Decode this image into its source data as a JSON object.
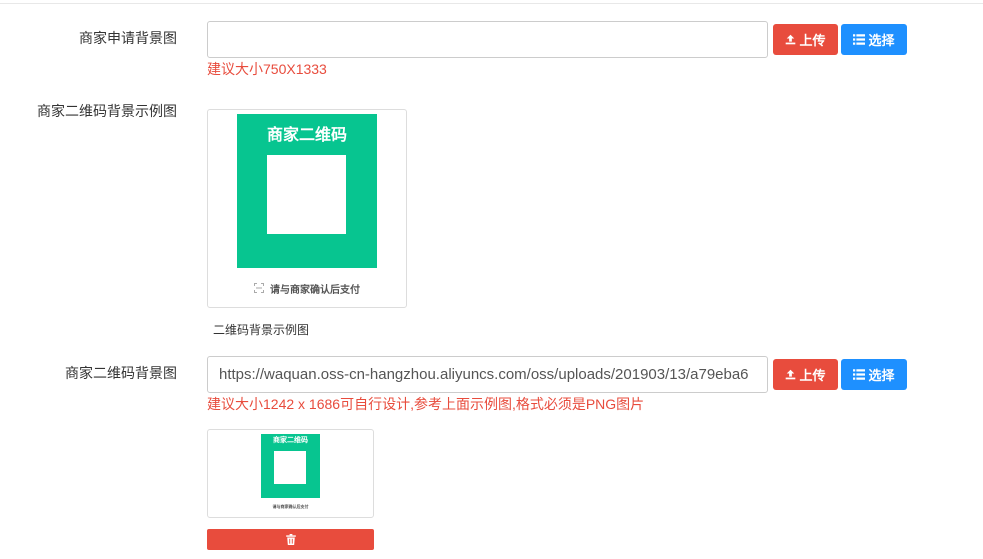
{
  "colors": {
    "danger": "#e84c3d",
    "primary": "#1e90ff",
    "qr_green": "#07c590",
    "hint_text": "#e84c3d",
    "label_text": "#333333"
  },
  "icons": {
    "upload": "upload-icon",
    "select": "list-icon",
    "delete": "trash-icon",
    "scan": "scan-icon"
  },
  "form": {
    "apply_background": {
      "label": "商家申请背景图",
      "upload_label": "上传",
      "select_label": "选择",
      "hint": "建议大小750X1333"
    },
    "qr_sample": {
      "label": "商家二维码背景示例图",
      "preview_title": "商家二维码",
      "preview_footer": "请与商家确认后支付",
      "caption": "二维码背景示例图"
    },
    "qr_background": {
      "label": "商家二维码背景图",
      "input_value": "https://waquan.oss-cn-hangzhou.aliyuncs.com/oss/uploads/201903/13/a79eba6",
      "upload_label": "上传",
      "select_label": "选择",
      "hint": "建议大小1242 x 1686可自行设计,参考上面示例图,格式必须是PNG图片",
      "preview_title": "商家二维码",
      "preview_footer": "请与商家确认后支付"
    }
  }
}
